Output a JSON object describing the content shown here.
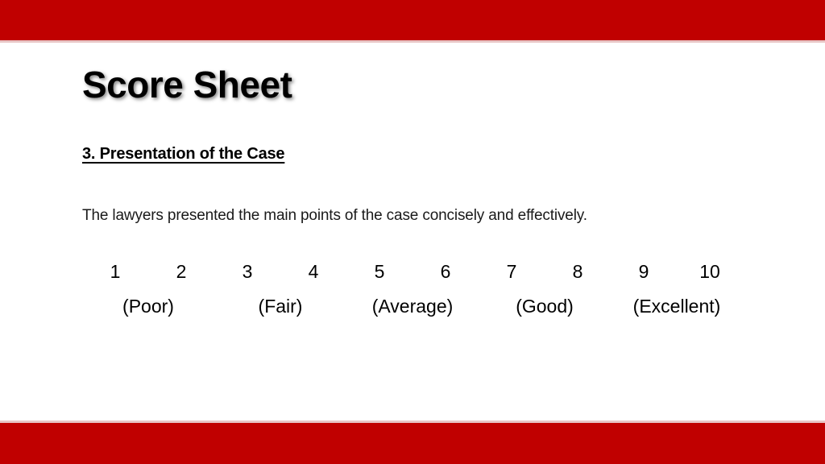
{
  "slide": {
    "title": "Score Sheet",
    "section_heading": "3. Presentation of the Case",
    "criterion_text": "The lawyers presented the main points of the case concisely and effectively.",
    "accent_color": "#C00000",
    "rule_color": "#E8C6C6",
    "text_color": "#000000"
  },
  "scale": {
    "numbers": [
      "1",
      "2",
      "3",
      "4",
      "5",
      "6",
      "7",
      "8",
      "9",
      "10"
    ],
    "labels": [
      "(Poor)",
      "(Fair)",
      "(Average)",
      "(Good)",
      "(Excellent)"
    ]
  }
}
